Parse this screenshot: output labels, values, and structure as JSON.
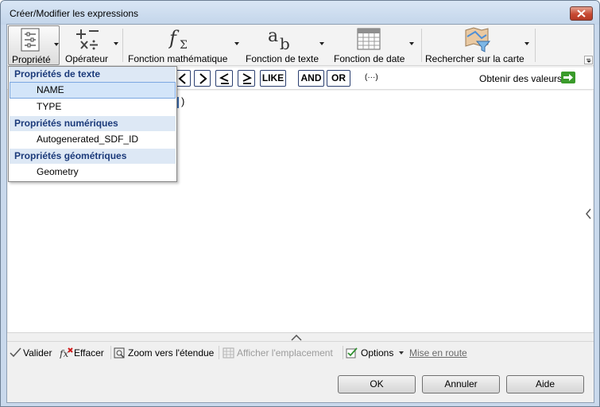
{
  "window": {
    "title": "Créer/Modifier les expressions"
  },
  "ribbon": {
    "items": [
      {
        "label": "Propriété",
        "icon": "property-list-icon",
        "selected": true
      },
      {
        "label": "Opérateur",
        "icon": "operator-icon"
      },
      {
        "label": "Fonction mathématique",
        "icon": "math-function-icon"
      },
      {
        "label": "Fonction de texte",
        "icon": "text-function-icon"
      },
      {
        "label": "Fonction de date",
        "icon": "calendar-icon"
      },
      {
        "label": "Rechercher sur la carte",
        "icon": "map-search-icon"
      }
    ]
  },
  "operators": {
    "buttons": [
      "<",
      ">",
      "≤",
      "≥",
      "LIKE",
      "AND",
      "OR"
    ],
    "ellipsis": "(···)",
    "values_label": "Obtenir des valeurs"
  },
  "editor": {
    "text": ")"
  },
  "dropdown": {
    "groups": [
      {
        "header": "Propriétés de texte",
        "items": [
          "NAME",
          "TYPE"
        ]
      },
      {
        "header": "Propriétés numériques",
        "items": [
          "Autogenerated_SDF_ID"
        ]
      },
      {
        "header": "Propriétés géométriques",
        "items": [
          "Geometry"
        ]
      }
    ],
    "highlighted": "NAME"
  },
  "bottom_toolbar": {
    "validate": "Valider",
    "clear": "Effacer",
    "zoom": "Zoom vers l'étendue",
    "show_location": "Afficher l'emplacement",
    "options": "Options",
    "getting_started": "Mise en route"
  },
  "buttons": {
    "ok": "OK",
    "cancel": "Annuler",
    "help": "Aide"
  },
  "colors": {
    "accent_blue": "#3d6fb6",
    "header_text": "#1b3a7a",
    "green_arrow": "#3a9b2b"
  }
}
